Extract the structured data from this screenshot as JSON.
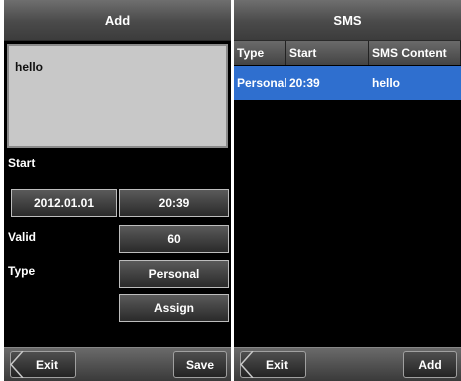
{
  "add_screen": {
    "title": "Add",
    "message": "hello",
    "start_label": "Start",
    "start_date": "2012.01.01",
    "start_time": "20:39",
    "valid_label": "Valid",
    "valid_value": "60",
    "type_label": "Type",
    "type_value": "Personal",
    "assign_label": "Assign",
    "exit_label": "Exit",
    "save_label": "Save"
  },
  "sms_screen": {
    "title": "SMS",
    "columns": [
      "Type",
      "Start",
      "SMS Content"
    ],
    "rows": [
      [
        "Personal",
        "20:39",
        "hello"
      ]
    ],
    "exit_label": "Exit",
    "add_label": "Add"
  },
  "colors": {
    "background": "#000000",
    "selected_row": "#2f6fcf",
    "message_box": "#c8c8c8"
  },
  "icons": {
    "exit": "chevron-left-icon"
  }
}
